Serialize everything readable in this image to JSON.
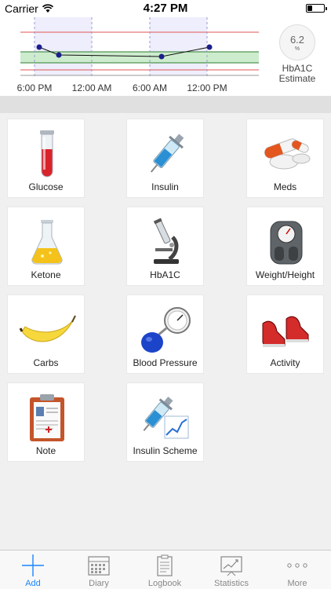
{
  "status_bar": {
    "carrier": "Carrier",
    "time": "4:27 PM"
  },
  "chart": {
    "x_ticks": [
      "6:00 PM",
      "12:00 AM",
      "6:00 AM",
      "12:00 PM"
    ],
    "line_color": "#111111",
    "marker_color": "#1b1f8a",
    "target_band_color": "#cdeccd",
    "limit_line_color": "#e05555"
  },
  "hba1c": {
    "value": "6.2",
    "unit": "%",
    "label_line1": "HbA1C",
    "label_line2": "Estimate"
  },
  "tiles": [
    {
      "label": "Glucose",
      "icon": "test-tube-icon"
    },
    {
      "label": "Insulin",
      "icon": "syringe-icon"
    },
    {
      "label": "Meds",
      "icon": "pills-icon"
    },
    {
      "label": "Ketone",
      "icon": "flask-icon"
    },
    {
      "label": "HbA1C",
      "icon": "microscope-icon"
    },
    {
      "label": "Weight/Height",
      "icon": "scale-icon"
    },
    {
      "label": "Carbs",
      "icon": "banana-icon"
    },
    {
      "label": "Blood Pressure",
      "icon": "blood-pressure-gauge-icon"
    },
    {
      "label": "Activity",
      "icon": "sneakers-icon"
    },
    {
      "label": "Note",
      "icon": "clipboard-icon"
    },
    {
      "label": "Insulin Scheme",
      "icon": "syringe-chart-icon"
    }
  ],
  "tabs": [
    {
      "label": "Add",
      "icon": "plus-icon",
      "active": true
    },
    {
      "label": "Diary",
      "icon": "calendar-icon"
    },
    {
      "label": "Logbook",
      "icon": "notepad-icon"
    },
    {
      "label": "Statistics",
      "icon": "chart-icon"
    },
    {
      "label": "More",
      "icon": "more-icon"
    }
  ],
  "colors": {
    "accent": "#1a84ff",
    "background": "#f0f0f0"
  }
}
